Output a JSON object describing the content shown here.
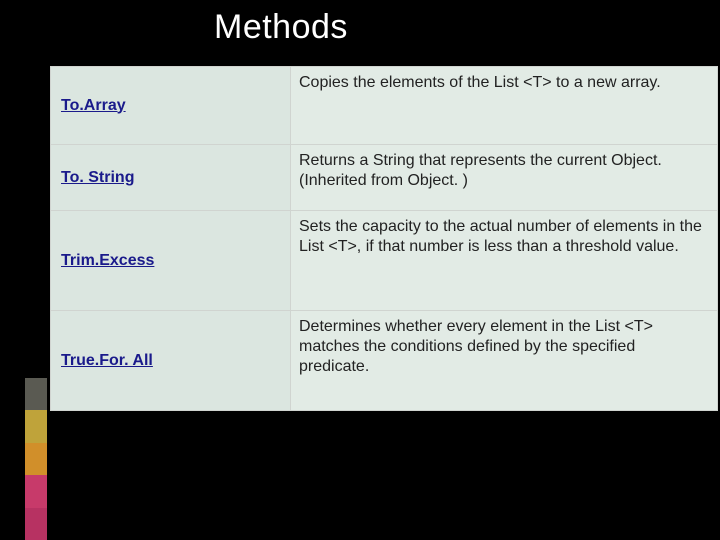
{
  "title": "Methods",
  "accent_colors": [
    "#5a5a52",
    "#bfa33a",
    "#d18f2a",
    "#c73a6a",
    "#b73262"
  ],
  "rows": [
    {
      "name": "To.Array",
      "desc": "Copies the elements of the List <T> to a new array."
    },
    {
      "name": "To. String",
      "desc": "Returns a String that represents the current Object. (Inherited from Object. )"
    },
    {
      "name": "Trim.Excess",
      "desc": "Sets the capacity to the actual number of elements in the List <T>, if that number is less than a threshold value."
    },
    {
      "name": "True.For. All",
      "desc": "Determines whether every element in the List <T> matches the conditions defined by the specified predicate."
    }
  ]
}
